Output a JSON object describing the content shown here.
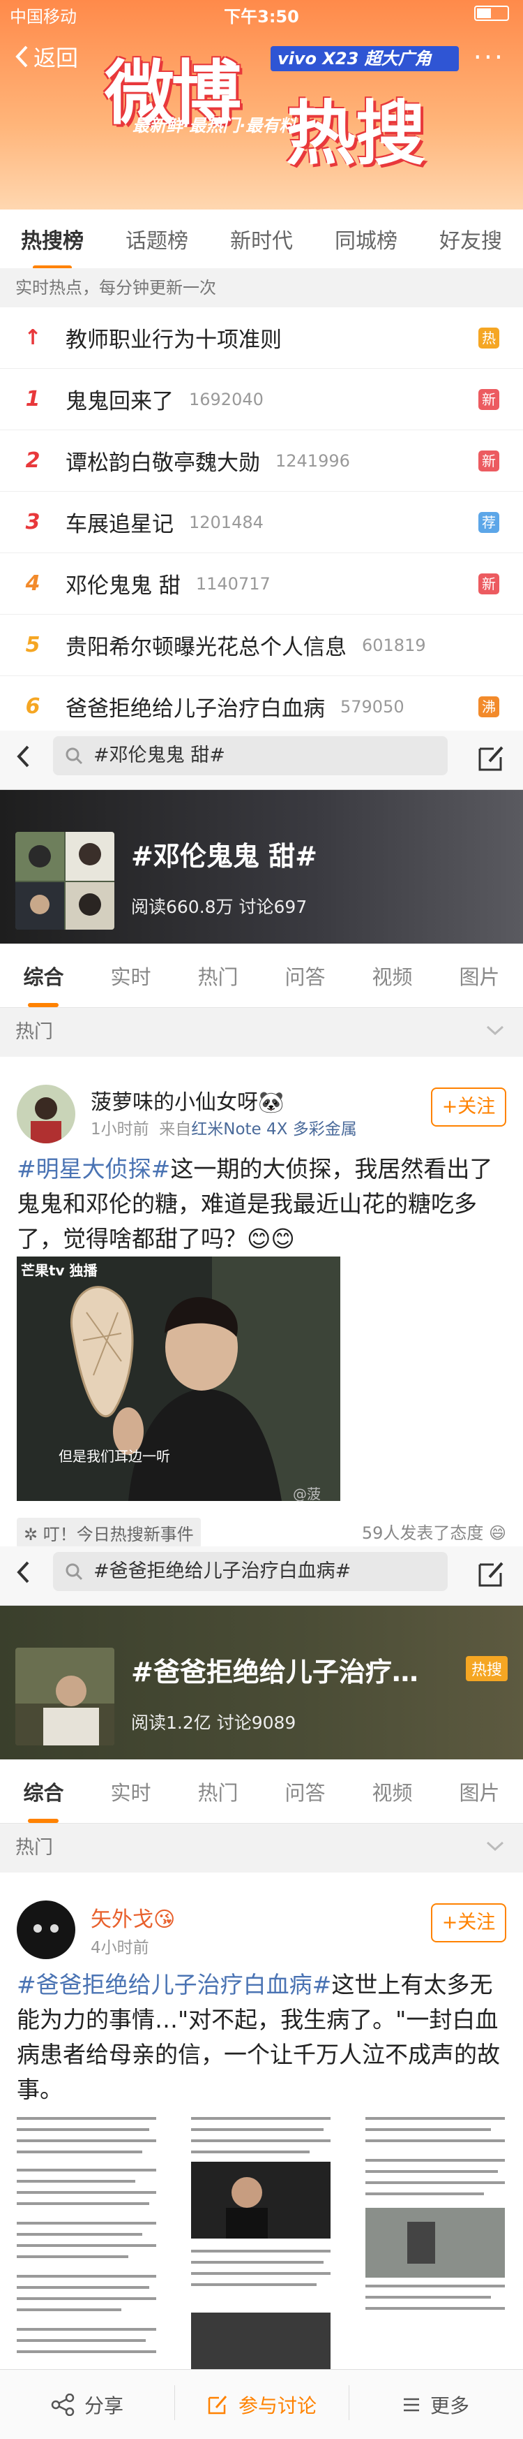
{
  "status_bar": {
    "carrier": "中国移动",
    "time": "下午3:50"
  },
  "header": {
    "back_label": "返回",
    "banner_title_1": "微博",
    "banner_title_2": "热搜",
    "banner_badge": "vivo X23 超大广角",
    "banner_sub": "最新鲜·最热门·最有料",
    "more_label": "···"
  },
  "tabs": [
    {
      "label": "热搜榜",
      "active": true
    },
    {
      "label": "话题榜"
    },
    {
      "label": "新时代"
    },
    {
      "label": "同城榜"
    },
    {
      "label": "好友搜"
    }
  ],
  "hint": "实时热点，每分钟更新一次",
  "rank_list": [
    {
      "rank": "↑",
      "title": "教师职业行为十项准则",
      "count": "",
      "badge": "热",
      "badge_color": "#f5a623",
      "rank_color": "#e8383b"
    },
    {
      "rank": "1",
      "title": "鬼鬼回来了",
      "count": "1692040",
      "badge": "新",
      "badge_color": "#ec5b60",
      "rank_color": "#e8383b"
    },
    {
      "rank": "2",
      "title": "谭松韵白敬亭魏大勋",
      "count": "1241996",
      "badge": "新",
      "badge_color": "#ec5b60",
      "rank_color": "#e8383b"
    },
    {
      "rank": "3",
      "title": "车展追星记",
      "count": "1201484",
      "badge": "荐",
      "badge_color": "#5ca6e8",
      "rank_color": "#e8383b"
    },
    {
      "rank": "4",
      "title": "邓伦鬼鬼 甜",
      "count": "1140717",
      "badge": "新",
      "badge_color": "#ec5b60",
      "rank_color": "#f28a2b"
    },
    {
      "rank": "5",
      "title": "贵阳希尔顿曝光花总个人信息",
      "count": "601819",
      "badge": "",
      "badge_color": "",
      "rank_color": "#f5a623"
    },
    {
      "rank": "6",
      "title": "爸爸拒绝给儿子治疗白血病",
      "count": "579050",
      "badge": "沸",
      "badge_color": "#f28a2b",
      "rank_color": "#f5a623"
    }
  ],
  "topic1": {
    "search_text": "#邓伦鬼鬼 甜#",
    "title": "#邓伦鬼鬼 甜#",
    "stats": "阅读660.8万  讨论697",
    "subtabs": [
      "综合",
      "实时",
      "热门",
      "问答",
      "视频",
      "图片"
    ],
    "section": "热门",
    "post": {
      "username": "菠萝味的小仙女呀🐼",
      "time": "1小时前",
      "source_prefix": "来自",
      "source": "红米Note 4X 多彩金属",
      "follow_label": "+关注",
      "hashtag": "#明星大侦探#",
      "text": "这一期的大侦探，我居然看出了鬼鬼和邓伦的糖，难道是我最近山花的糖吃多了，觉得啥都甜了吗？😊😊",
      "image_caption_tv": "芒果tv 独播",
      "image_caption_sub": "但是我们耳边一听",
      "image_watermark": "@菠",
      "event_label": "✲ 叮！今日热搜新事件",
      "event_count": "59人发表了态度 😄"
    }
  },
  "topic2": {
    "search_text": "#爸爸拒绝给儿子治疗白血病#",
    "title": "#爸爸拒绝给儿子治疗…",
    "badge": "热搜",
    "stats": "阅读1.2亿  讨论9089",
    "subtabs": [
      "综合",
      "实时",
      "热门",
      "问答",
      "视频",
      "图片"
    ],
    "section": "热门",
    "post": {
      "username": "矢外戈😘",
      "time": "4小时前",
      "follow_label": "+关注",
      "hashtag": "#爸爸拒绝给儿子治疗白血病#",
      "text": "这世上有太多无能为力的事情…\"对不起，我生病了。\"一封白血病患者给母亲的信，一个让千万人泣不成声的故事。"
    }
  },
  "bottom_bar": {
    "share": "分享",
    "discuss": "参与讨论",
    "more": "更多"
  },
  "colors": {
    "accent": "#ff8200",
    "link": "#4a73b3"
  }
}
